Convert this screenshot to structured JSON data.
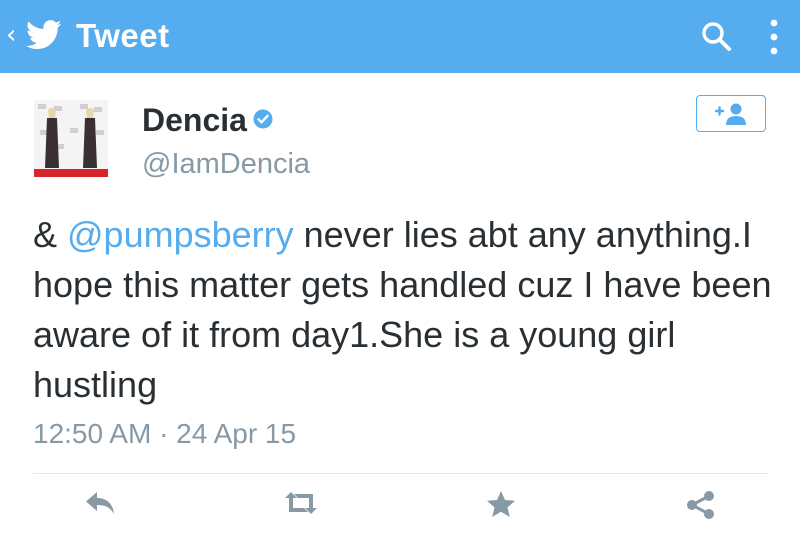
{
  "header": {
    "back_glyph": "‹",
    "logo_icon": "twitter-bird-icon",
    "title": "Tweet",
    "search_icon": "search-icon",
    "menu_icon": "more-vertical-icon",
    "bar_color": "#55acee"
  },
  "tweet": {
    "author": {
      "name": "Dencia",
      "handle": "@IamDencia",
      "verified": true
    },
    "follow_icon": "add-user-icon",
    "text": {
      "prefix": "& ",
      "mention": "@pumpsberry",
      "body": " never lies abt any anything.I hope this matter gets handled cuz I have been aware of it from day1.She is a young girl hustling"
    },
    "timestamp": "12:50 AM · 24 Apr 15"
  },
  "actions": [
    {
      "name": "reply",
      "icon": "reply-icon"
    },
    {
      "name": "retweet",
      "icon": "retweet-icon"
    },
    {
      "name": "favorite",
      "icon": "star-icon"
    },
    {
      "name": "share",
      "icon": "share-icon"
    }
  ],
  "colors": {
    "accent": "#55acee",
    "text": "#292f33",
    "muted": "#8899a6",
    "action_icon": "#8899a6"
  }
}
